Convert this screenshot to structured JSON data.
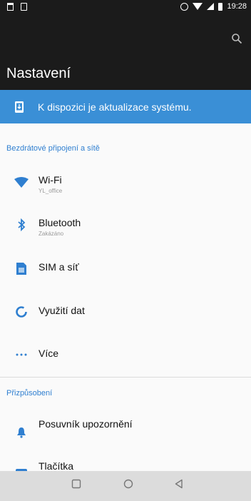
{
  "status_bar": {
    "time": "19:28",
    "icons": [
      "shopping-bag-icon",
      "sd-card-icon",
      "alarm-icon",
      "wifi-icon",
      "signal-icon",
      "battery-icon"
    ]
  },
  "toolbar": {
    "title": "Nastavení",
    "search_icon": "search-icon"
  },
  "update_banner": {
    "text": "K dispozici je aktualizace systému.",
    "icon": "system-update-icon",
    "color": "#3a8fd6"
  },
  "sections": [
    {
      "header": "Bezdrátové připojení a sítě",
      "items": [
        {
          "label": "Wi-Fi",
          "sub": "YL_office",
          "icon": "wifi-icon"
        },
        {
          "label": "Bluetooth",
          "sub": "Zakázáno",
          "icon": "bluetooth-icon"
        },
        {
          "label": "SIM a síť",
          "sub": "",
          "icon": "sim-card-icon"
        },
        {
          "label": "Využití dat",
          "sub": "",
          "icon": "data-usage-icon"
        },
        {
          "label": "Více",
          "sub": "",
          "icon": "more-icon"
        }
      ]
    },
    {
      "header": "Přizpůsobení",
      "items": [
        {
          "label": "Posuvník upozornění",
          "sub": "",
          "icon": "notification-bell-icon"
        },
        {
          "label": "Tlačítka",
          "sub": "",
          "icon": "buttons-icon"
        }
      ]
    }
  ],
  "nav_bar": {
    "buttons": [
      "recents-icon",
      "home-icon",
      "back-icon"
    ]
  },
  "colors": {
    "accent": "#2f7fd0",
    "toolbar_bg": "#1b1b1b",
    "banner_bg": "#3a8fd6",
    "nav_bg": "#dcdcdc"
  }
}
